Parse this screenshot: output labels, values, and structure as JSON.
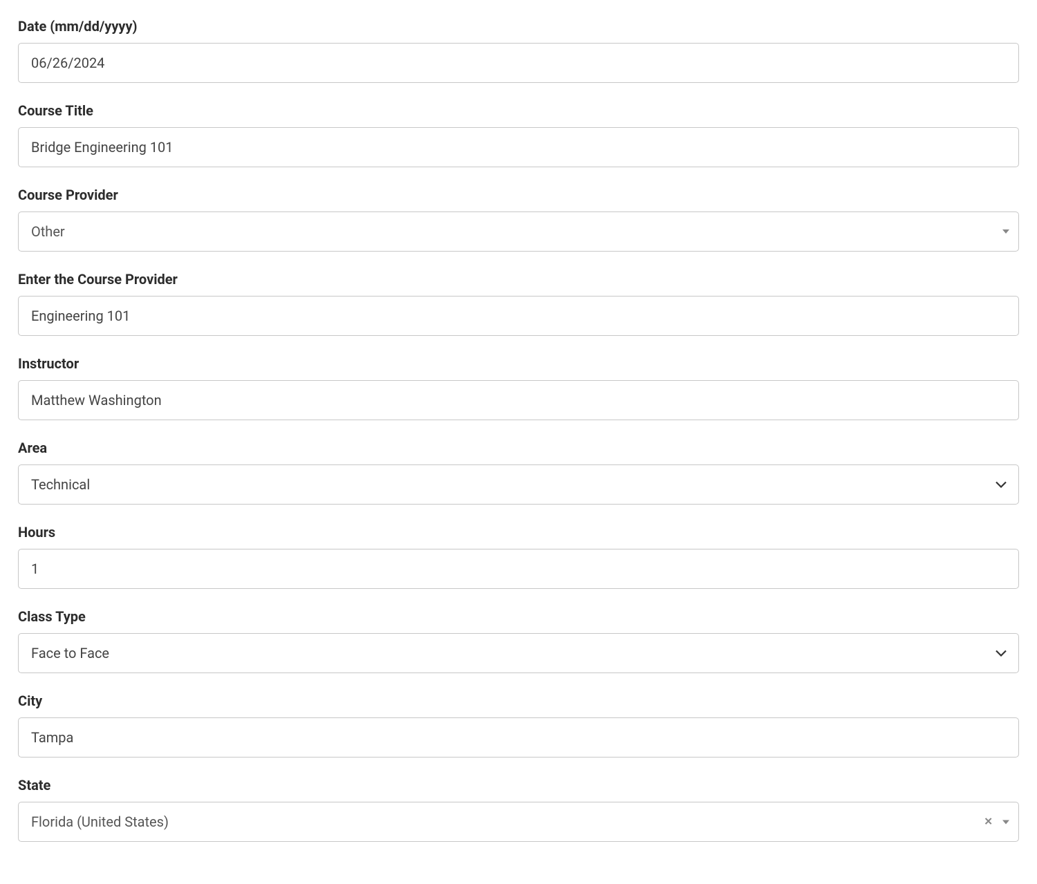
{
  "form": {
    "date": {
      "label": "Date (mm/dd/yyyy)",
      "value": "06/26/2024"
    },
    "courseTitle": {
      "label": "Course Title",
      "value": "Bridge Engineering 101"
    },
    "courseProvider": {
      "label": "Course Provider",
      "value": "Other"
    },
    "enterCourseProvider": {
      "label": "Enter the Course Provider",
      "value": "Engineering 101"
    },
    "instructor": {
      "label": "Instructor",
      "value": "Matthew Washington"
    },
    "area": {
      "label": "Area",
      "value": "Technical"
    },
    "hours": {
      "label": "Hours",
      "value": "1"
    },
    "classType": {
      "label": "Class Type",
      "value": "Face to Face"
    },
    "city": {
      "label": "City",
      "value": "Tampa"
    },
    "state": {
      "label": "State",
      "value": "Florida (United States)"
    }
  }
}
